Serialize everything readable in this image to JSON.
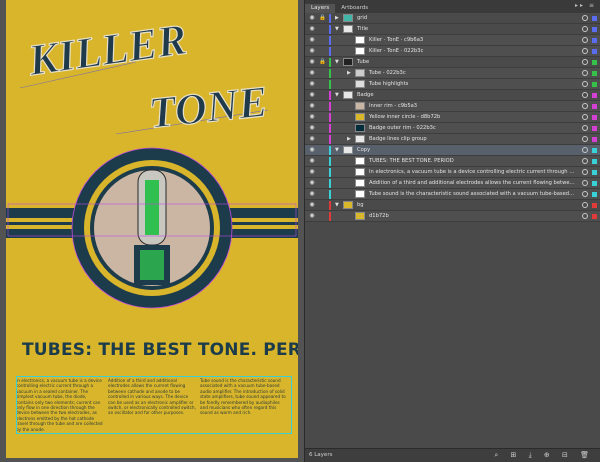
{
  "artboard": {
    "title_line1": "KILLER",
    "title_line2": "TONE",
    "headline": "TUBES: THE BEST TONE. PERIOD",
    "body_col1": "In electronics, a vacuum tube is a device controlling electric current through a vacuum in a sealed container. The simplest vacuum tube, the diode, contains only two elements; current can only flow in one direction through the device between the two electrodes, as electrons emitted by the hot cathode travel through the tube and are collected by the anode.",
    "body_col2": "Addition of a third and additional electrodes allows the current flowing between cathode and anode to be controlled in various ways. The device can be used as an electronic amplifier or switch, or electronically controlled switch, an oscillator and for other purposes.",
    "body_col3": "Tube sound is the characteristic sound associated with a vacuum tube-based audio amplifier. The introduction of solid state amplifiers, tube sound appeared to be fondly remembered by audiophiles and musicians who often regard this sound as warm and rich."
  },
  "panel": {
    "tabs": [
      "Layers",
      "Artboards"
    ],
    "tab_tools": "▸▸ ≡",
    "footer_label": "6 Layers",
    "footer_tools": "⌕ ⊞ ⤓ ⊕ ⊟ 🗑"
  },
  "layers": [
    {
      "name": "grid",
      "level": 0,
      "color": "#5b6cf0",
      "thumb": "#3fb6a8",
      "expanded": false,
      "locked": true,
      "target_box": "#5b6cf0"
    },
    {
      "name": "Title",
      "level": 0,
      "color": "#5b6cf0",
      "thumb": "#e8e8e8",
      "expanded": true,
      "locked": false,
      "target_box": "#5b6cf0"
    },
    {
      "name": "Killer · TonE · c9b6a3",
      "level": 1,
      "color": "#5b6cf0",
      "thumb": "#ffffff",
      "locked": false,
      "target_box": "#5b6cf0"
    },
    {
      "name": "Killer · TonE · 022b3c",
      "level": 1,
      "color": "#5b6cf0",
      "thumb": "#ffffff",
      "locked": false,
      "target_box": "#5b6cf0"
    },
    {
      "name": "Tube",
      "level": 0,
      "color": "#36c24a",
      "thumb": "#222222",
      "expanded": true,
      "locked": true,
      "target_box": "#36c24a"
    },
    {
      "name": "Tube - 022b3c",
      "level": 1,
      "color": "#36c24a",
      "thumb": "#cccccc",
      "expanded": false,
      "locked": false,
      "target_box": "#36c24a"
    },
    {
      "name": "Tube highlights",
      "level": 1,
      "color": "#36c24a",
      "thumb": "#dddddd",
      "locked": false,
      "target_box": "#36c24a"
    },
    {
      "name": "Badge",
      "level": 0,
      "color": "#d43fd4",
      "thumb": "#e8e8e8",
      "expanded": true,
      "locked": false,
      "target_box": "#d43fd4"
    },
    {
      "name": "Inner rim - c9b5a3",
      "level": 1,
      "color": "#d43fd4",
      "thumb": "#c9b5a3",
      "locked": false,
      "target_box": "#d43fd4"
    },
    {
      "name": "Yellow inner circle - d8b72b",
      "level": 1,
      "color": "#d43fd4",
      "thumb": "#d8b72b",
      "locked": false,
      "target_box": "#d43fd4"
    },
    {
      "name": "Badge outer rim - 022b3c",
      "level": 1,
      "color": "#d43fd4",
      "thumb": "#022b3c",
      "locked": false,
      "target_box": "#d43fd4"
    },
    {
      "name": "Badge lines clip group",
      "level": 1,
      "color": "#d43fd4",
      "thumb": "#e8e8e8",
      "expanded": false,
      "locked": false,
      "target_box": "#d43fd4"
    },
    {
      "name": "Copy",
      "level": 0,
      "color": "#3ad0d8",
      "thumb": "#e8e8e8",
      "expanded": true,
      "locked": false,
      "target_box": "#3ad0d8",
      "highlight": true
    },
    {
      "name": "TUBES: THE BEST TONE. PERIOD",
      "level": 1,
      "color": "#3ad0d8",
      "thumb": "#ffffff",
      "locked": false,
      "target_box": "#3ad0d8"
    },
    {
      "name": "In electronics, a vacuum tube is a device controlling electric current through a vacuum in...",
      "level": 1,
      "color": "#3ad0d8",
      "thumb": "#ffffff",
      "locked": false,
      "target_box": "#3ad0d8"
    },
    {
      "name": "Addition of a third and additional electrodes allows the current flowing between cathode a...",
      "level": 1,
      "color": "#3ad0d8",
      "thumb": "#ffffff",
      "locked": false,
      "target_box": "#3ad0d8"
    },
    {
      "name": "Tube sound is the characteristic sound associated with a vacuum tube-based audio amplif...",
      "level": 1,
      "color": "#3ad0d8",
      "thumb": "#ffffff",
      "locked": false,
      "target_box": "#3ad0d8"
    },
    {
      "name": "bg",
      "level": 0,
      "color": "#e03a3a",
      "thumb": "#d8b72b",
      "expanded": true,
      "locked": false,
      "target_box": "#e03a3a"
    },
    {
      "name": "d1b72b",
      "level": 1,
      "color": "#e03a3a",
      "thumb": "#d8b72b",
      "locked": false,
      "target_box": "#e03a3a"
    }
  ]
}
